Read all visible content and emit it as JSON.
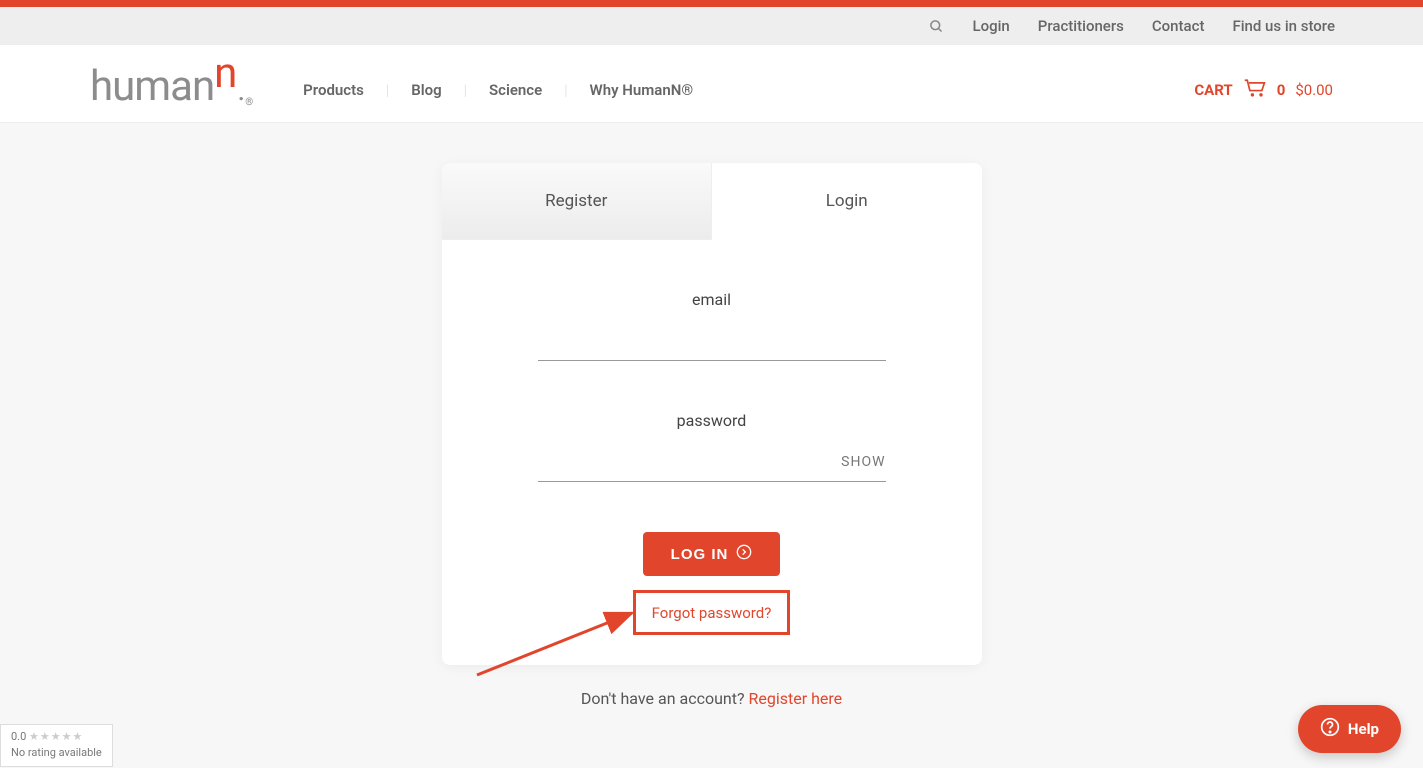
{
  "top_nav": {
    "login": "Login",
    "practitioners": "Practitioners",
    "contact": "Contact",
    "find_store": "Find us in store"
  },
  "main_nav": {
    "products": "Products",
    "blog": "Blog",
    "science": "Science",
    "why": "Why HumanN®"
  },
  "logo": {
    "base": "human",
    "n": "n",
    "dot": "."
  },
  "cart": {
    "label": "CART",
    "count": "0",
    "total": "$0.00"
  },
  "tabs": {
    "register": "Register",
    "login": "Login"
  },
  "form": {
    "email_label": "email",
    "password_label": "password",
    "show": "SHOW",
    "login_btn": "LOG IN",
    "forgot": "Forgot password?"
  },
  "register_prompt": {
    "text": "Don't have an account? ",
    "link": "Register here"
  },
  "help": {
    "label": "Help"
  },
  "google_reviews": {
    "rating": "0.0",
    "stars": "★★★★★",
    "text": "No rating available"
  }
}
